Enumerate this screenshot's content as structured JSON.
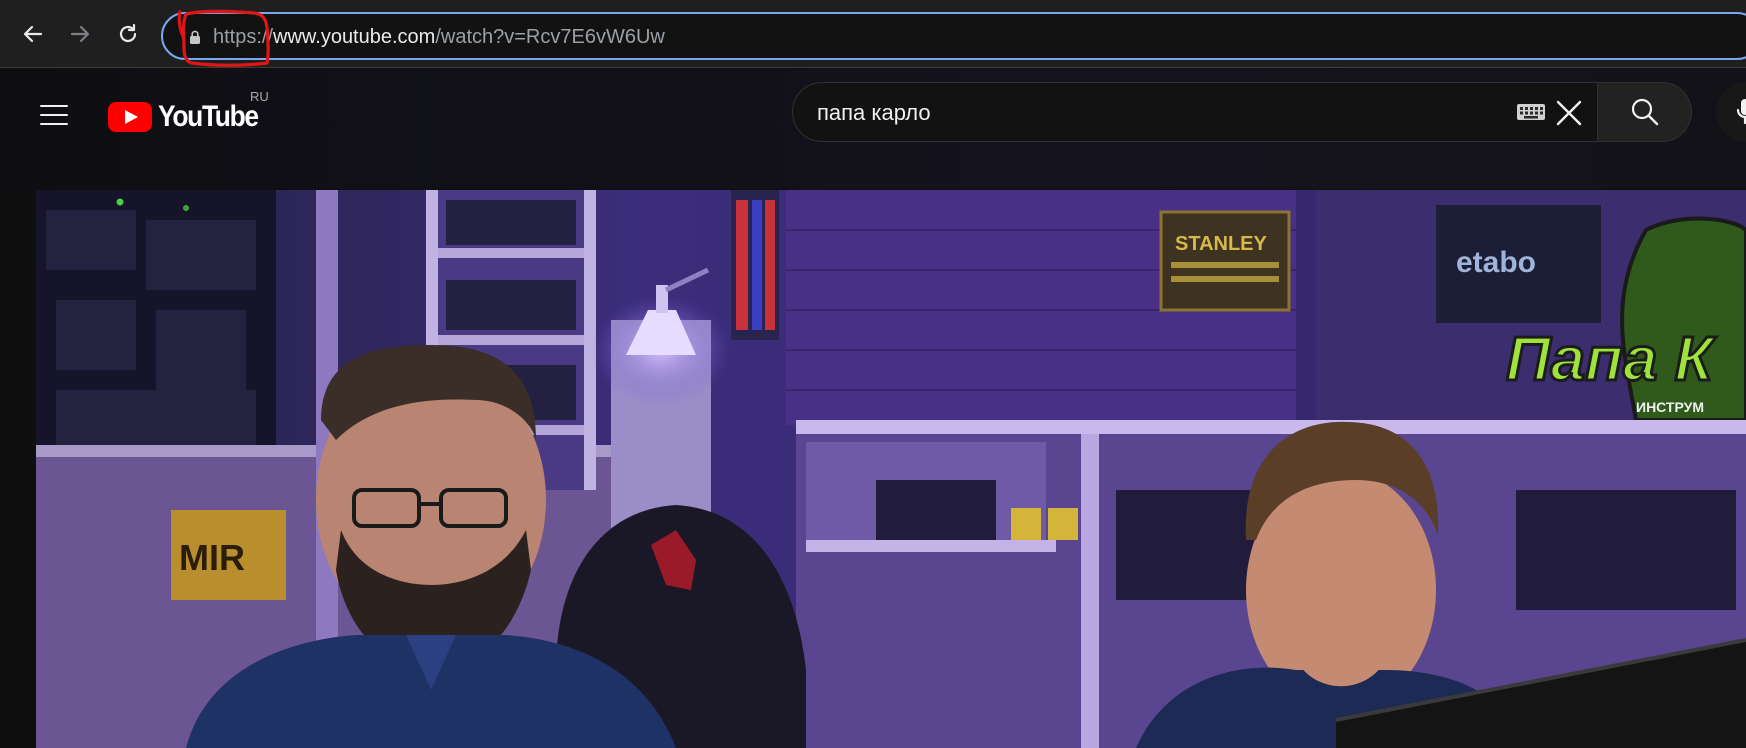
{
  "browser": {
    "url_scheme": "https://",
    "url_host": "www.youtube.com",
    "url_path": "/watch?v=Rcv7E6vW6Uw",
    "annotation_color": "#e01616"
  },
  "youtube": {
    "logo_text": "YouTube",
    "region": "RU",
    "search_query": "папа карло",
    "brand_color": "#ff0000"
  },
  "video": {
    "sign_stanley": "STANLEY",
    "sign_metabo": "etabo",
    "sign_mir": "MIR",
    "channel_logo_text": "Папа К",
    "channel_logo_subtext": "ИНСТРУМ"
  }
}
